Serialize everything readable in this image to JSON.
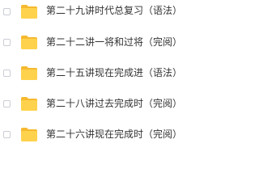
{
  "file_list": {
    "items": [
      {
        "name": "第二十九讲时代总复习（语法）",
        "icon": "folder-icon",
        "checked": false
      },
      {
        "name": "第二十二讲一将和过将（完阅）",
        "icon": "folder-icon",
        "checked": false
      },
      {
        "name": "第二十五讲现在完成进（语法）",
        "icon": "folder-icon",
        "checked": false
      },
      {
        "name": "第二十八讲过去完成时（完阅）",
        "icon": "folder-icon",
        "checked": false
      },
      {
        "name": "第二十六讲现在完成时（完阅）",
        "icon": "folder-icon",
        "checked": false
      }
    ]
  },
  "colors": {
    "folder_body": "#FFD24D",
    "folder_tab": "#F6B92F",
    "checkbox_border": "#C9CDD4",
    "text": "#333333"
  }
}
